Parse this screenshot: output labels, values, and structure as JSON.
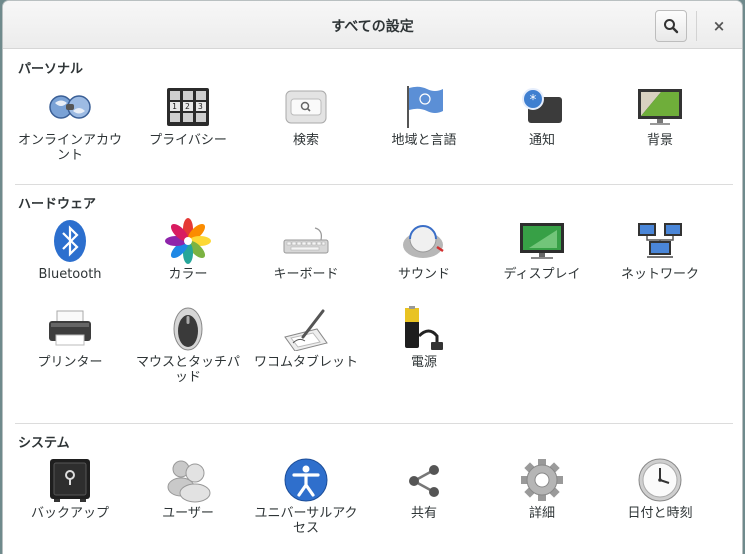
{
  "window": {
    "title": "すべての設定",
    "search_icon": "search-icon",
    "close_label": "×"
  },
  "sections": {
    "personal": {
      "title": "パーソナル",
      "items": [
        {
          "label": "オンラインアカウント",
          "icon": "online-accounts-icon"
        },
        {
          "label": "プライバシー",
          "icon": "privacy-icon"
        },
        {
          "label": "検索",
          "icon": "search-settings-icon"
        },
        {
          "label": "地域と言語",
          "icon": "region-language-icon"
        },
        {
          "label": "通知",
          "icon": "notifications-icon"
        },
        {
          "label": "背景",
          "icon": "background-icon"
        }
      ]
    },
    "hardware": {
      "title": "ハードウェア",
      "items": [
        {
          "label": "Bluetooth",
          "icon": "bluetooth-icon"
        },
        {
          "label": "カラー",
          "icon": "color-icon"
        },
        {
          "label": "キーボード",
          "icon": "keyboard-icon"
        },
        {
          "label": "サウンド",
          "icon": "sound-icon"
        },
        {
          "label": "ディスプレイ",
          "icon": "display-icon"
        },
        {
          "label": "ネットワーク",
          "icon": "network-icon"
        },
        {
          "label": "プリンター",
          "icon": "printer-icon"
        },
        {
          "label": "マウスとタッチパッド",
          "icon": "mouse-icon"
        },
        {
          "label": "ワコムタブレット",
          "icon": "wacom-tablet-icon"
        },
        {
          "label": "電源",
          "icon": "power-icon"
        }
      ]
    },
    "system": {
      "title": "システム",
      "items": [
        {
          "label": "バックアップ",
          "icon": "backup-icon"
        },
        {
          "label": "ユーザー",
          "icon": "users-icon"
        },
        {
          "label": "ユニバーサルアクセス",
          "icon": "universal-access-icon"
        },
        {
          "label": "共有",
          "icon": "sharing-icon"
        },
        {
          "label": "詳細",
          "icon": "details-icon"
        },
        {
          "label": "日付と時刻",
          "icon": "date-time-icon"
        }
      ]
    }
  }
}
